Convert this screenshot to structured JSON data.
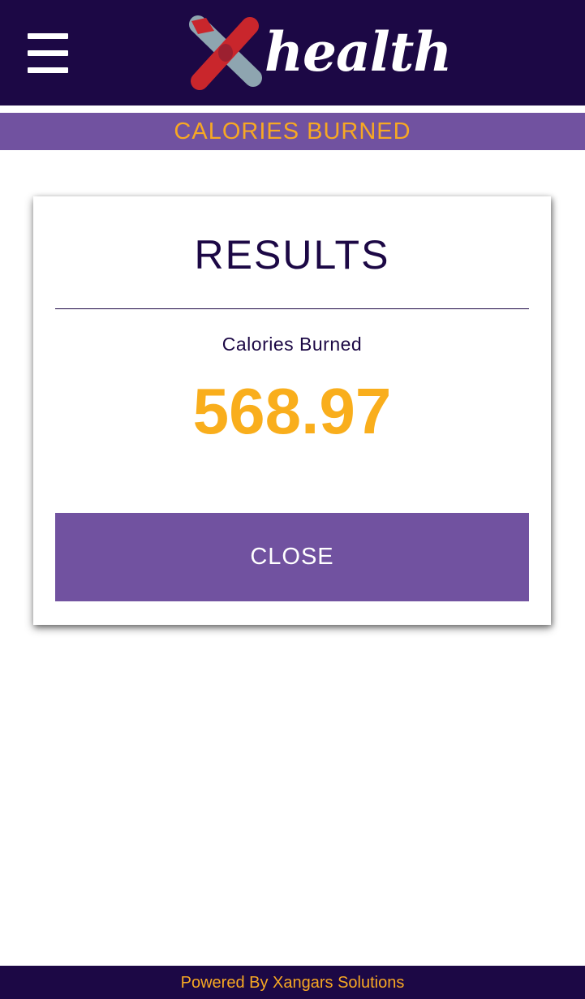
{
  "header": {
    "brand_text": "health",
    "menu_icon": "hamburger-menu-icon",
    "colors": {
      "background": "#1c0845",
      "logo_red": "#c9262c",
      "logo_steel": "#8ea5b0"
    }
  },
  "banner": {
    "title": "CALORIES BURNED",
    "background": "#7152a0",
    "text_color": "#f7a823"
  },
  "result_card": {
    "heading": "RESULTS",
    "metric_label": "Calories Burned",
    "metric_value": "568.97",
    "value_color": "#f9ae1c",
    "close_label": "CLOSE",
    "button_color": "#7152a0"
  },
  "footer": {
    "text": "Powered By Xangars Solutions"
  }
}
